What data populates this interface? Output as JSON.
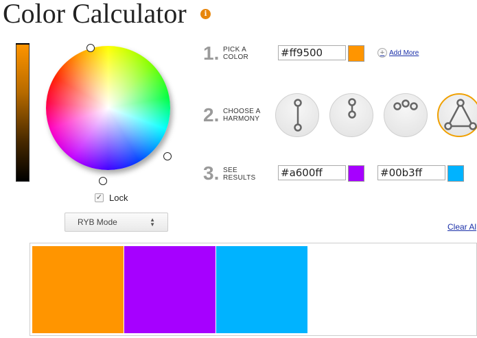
{
  "header": {
    "title": "Color Calculator",
    "info_icon": "info-icon"
  },
  "brightness": {
    "color": "#ff9500"
  },
  "picker": {
    "lock_label": "Lock",
    "lock_checked": true,
    "lock_mark": "✓"
  },
  "mode_select": {
    "value": "RYB Mode"
  },
  "steps": {
    "pick": {
      "number": "1.",
      "label_line1": "PICK A",
      "label_line2": "COLOR"
    },
    "harmony": {
      "number": "2.",
      "label_line1": "CHOOSE A",
      "label_line2": "HARMONY"
    },
    "results": {
      "number": "3.",
      "label_line1": "SEE",
      "label_line2": "RESULTS"
    }
  },
  "pick": {
    "hex_value": "#ff9500",
    "swatch_color": "#ff9500",
    "add_more_label": "Add More",
    "add_icon": "+"
  },
  "harmonies": [
    {
      "name": "complementary",
      "icon": "complementary-icon",
      "selected": false
    },
    {
      "name": "split-complementary",
      "icon": "split-icon",
      "selected": false
    },
    {
      "name": "analogous",
      "icon": "analogous-icon",
      "selected": false
    },
    {
      "name": "triadic",
      "icon": "triadic-icon",
      "selected": true
    }
  ],
  "results": [
    {
      "hex_value": "#a600ff",
      "swatch_color": "#a600ff"
    },
    {
      "hex_value": "#00b3ff",
      "swatch_color": "#00b3ff"
    }
  ],
  "clear_all_label": "Clear Al",
  "palette": {
    "colors": [
      "#ff9500",
      "#a600ff",
      "#00b3ff"
    ]
  }
}
